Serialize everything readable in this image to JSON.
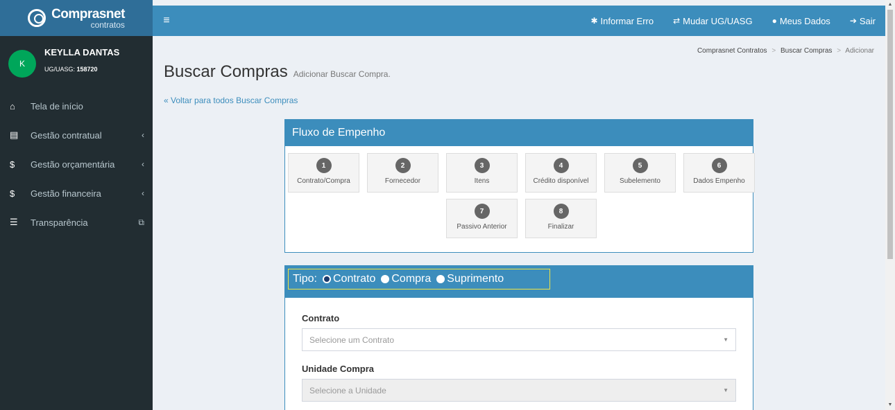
{
  "brand": {
    "name": "Comprasnet",
    "sub": "contratos"
  },
  "topbar": {
    "items": [
      {
        "icon": "✱",
        "label": "Informar Erro"
      },
      {
        "icon": "⇄",
        "label": "Mudar UG/UASG"
      },
      {
        "icon": "●",
        "label": "Meus Dados"
      },
      {
        "icon": "➔",
        "label": "Sair"
      }
    ]
  },
  "user": {
    "initial": "K",
    "name": "KEYLLA DANTAS",
    "uasg_label": "UG/UASG:",
    "uasg_value": "158720"
  },
  "sidebar": {
    "items": [
      {
        "icon": "⌂",
        "label": "Tela de início"
      },
      {
        "icon": "▤",
        "label": "Gestão contratual",
        "chevron": "‹"
      },
      {
        "icon": "$",
        "label": "Gestão orçamentária",
        "chevron": "‹"
      },
      {
        "icon": "$",
        "label": "Gestão financeira",
        "chevron": "‹"
      },
      {
        "icon": "☰",
        "label": "Transparência",
        "ext": "⧉"
      }
    ]
  },
  "breadcrumb": {
    "items": [
      "Comprasnet Contratos",
      "Buscar Compras"
    ],
    "current": "Adicionar",
    "sep": ">"
  },
  "page": {
    "title": "Buscar Compras",
    "subtitle": "Adicionar Buscar Compra.",
    "back": "« Voltar para todos Buscar Compras"
  },
  "flow": {
    "title": "Fluxo de Empenho",
    "steps": [
      {
        "num": "1",
        "label": "Contrato/Compra"
      },
      {
        "num": "2",
        "label": "Fornecedor"
      },
      {
        "num": "3",
        "label": "Itens"
      },
      {
        "num": "4",
        "label": "Crédito disponível"
      },
      {
        "num": "5",
        "label": "Subelemento"
      },
      {
        "num": "6",
        "label": "Dados Empenho"
      },
      {
        "num": "7",
        "label": "Passivo Anterior"
      },
      {
        "num": "8",
        "label": "Finalizar"
      }
    ]
  },
  "tipo": {
    "label": "Tipo:",
    "options": [
      {
        "label": "Contrato",
        "checked": true
      },
      {
        "label": "Compra",
        "checked": false
      },
      {
        "label": "Suprimento",
        "checked": false
      }
    ]
  },
  "form": {
    "contrato": {
      "label": "Contrato",
      "placeholder": "Selecione um Contrato"
    },
    "unidade": {
      "label": "Unidade Compra",
      "placeholder": "Selecione a Unidade"
    }
  }
}
